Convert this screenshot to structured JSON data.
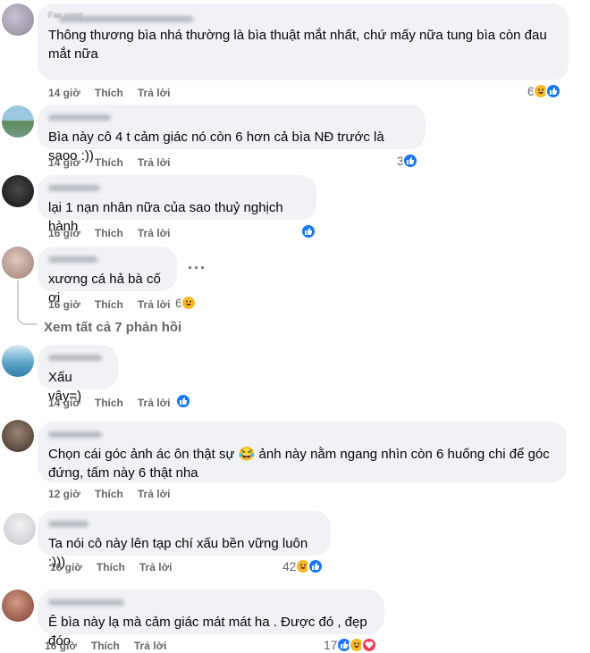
{
  "comments": [
    {
      "avatar_color": "#a8a3b2",
      "name_hint": "Fan cứng",
      "text": "Thông thương bìa nhá thường là bìa thuật mắt nhất, chứ mấy nữa tung bìa còn đau mắt nữa",
      "time": "14 giờ",
      "like": "Thích",
      "reply": "Trả lời",
      "reaction_count": "6",
      "reactions": [
        "haha",
        "like"
      ]
    },
    {
      "avatar_color": "#7fa7b8",
      "text": "Bìa này cô 4 t cảm giác nó còn 6 hơn cả bìa NĐ trước là saoo :))",
      "time": "14 giờ",
      "like": "Thích",
      "reply": "Trả lời",
      "reaction_count": "3",
      "reactions": [
        "like"
      ]
    },
    {
      "avatar_color": "#2b2b2b",
      "text": "lại 1 nạn nhân nữa của sao thuỷ nghịch hành",
      "time": "16 giờ",
      "like": "Thích",
      "reply": "Trả lời",
      "reaction_count": "",
      "reactions": [
        "like"
      ]
    },
    {
      "avatar_color": "#c9a8a0",
      "text": "xương cá hả bà cố ơi",
      "time": "16 giờ",
      "like": "Thích",
      "reply": "Trả lời",
      "reaction_count": "6",
      "reactions": [
        "haha"
      ],
      "more": "···"
    },
    {
      "avatar_color": "#5ea5c9",
      "text": "Xấu vậy=)",
      "time": "14 giờ",
      "like": "Thích",
      "reply": "Trả lời",
      "reaction_count": "",
      "reactions": [
        "like"
      ]
    },
    {
      "avatar_color": "#6b5a4e",
      "text": "Chọn cái góc ảnh ác ôn thật sự 😂 ảnh này nằm ngang nhìn còn 6 huống chi để góc đứng, tấm này 6 thật nha",
      "time": "12 giờ",
      "like": "Thích",
      "reply": "Trả lời",
      "reaction_count": "",
      "reactions": []
    },
    {
      "avatar_color": "#d9d9de",
      "text": "Ta nói cô này lên tạp chí xấu bền vững luôn :)))",
      "time": "16 giờ",
      "like": "Thích",
      "reply": "Trả lời",
      "reaction_count": "42",
      "reactions": [
        "haha",
        "like"
      ]
    },
    {
      "avatar_color": "#a86a5a",
      "text": "Ê bìa này lạ mà cảm giác mát mát ha . Được đó , đẹp đóo",
      "time": "16 giờ",
      "like": "Thích",
      "reply": "Trả lời",
      "reaction_count": "17",
      "reactions": [
        "like",
        "haha",
        "love"
      ]
    }
  ],
  "view_replies": "Xem tất cả 7 phản hồi",
  "colors": {
    "like": "#1877f2",
    "haha": "#f7b928",
    "love": "#f33e58",
    "bubble": "#f0f2f5",
    "meta": "#65676b"
  }
}
